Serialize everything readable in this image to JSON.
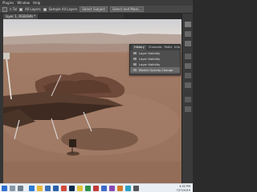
{
  "menubar": {
    "items": [
      "Plugins",
      "Window",
      "Help"
    ]
  },
  "options_bar": {
    "labels": [
      "All Layers",
      "Sample All Layers"
    ],
    "buttons": [
      "Select Subject",
      "Select and Mask..."
    ],
    "indicator": "n Tol"
  },
  "document": {
    "tab_label": "layer 1, RGB/8#) *",
    "close_glyph": "×"
  },
  "history_panel": {
    "tabs": [
      "History",
      "Channels",
      "Paths",
      "Info"
    ],
    "active_tab": "History",
    "entries": [
      "Layer Visibility",
      "Layer Visibility",
      "Layer Visibility",
      "Master Opacity Change"
    ],
    "selected_index": 3
  },
  "taskbar": {
    "time": "4:52 PM",
    "date": "7/27/2019",
    "icons": [
      "search-icon",
      "task-view-icon",
      "edge-icon",
      "files-icon",
      "store-icon",
      "mail-icon",
      "app-icon",
      "photoshop-icon",
      "chrome-icon",
      "app-icon-2",
      "app-icon-3",
      "app-icon-4",
      "app-icon-5",
      "app-icon-6",
      "app-icon-7",
      "app-icon-8"
    ]
  },
  "colors": {
    "chrome_bg": "#2b2b2b",
    "panel_bg": "#4e4e4e",
    "sky": "#d7d7da",
    "ground": "#a07c64",
    "taskbar": "#e9eef4"
  }
}
